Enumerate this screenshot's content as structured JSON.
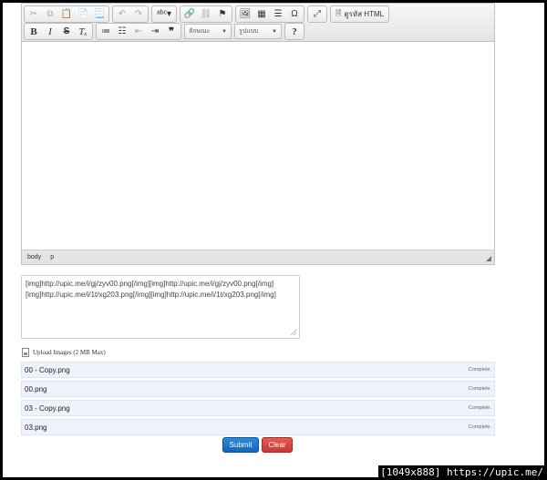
{
  "toolbar": {
    "source_label": "ดูรหัส HTML",
    "format_combo": "ลักษณะ",
    "style_combo": "รูปแบบ",
    "help_label": "?"
  },
  "statusbar": {
    "path": [
      "body",
      "p"
    ]
  },
  "bbcode": {
    "lines": [
      "[img]http://upic.me/i/gj/zyv00.png[/img][img]http://upic.me/i/gj/zyv00.png[/img]",
      "[img]http://upic.me/i/1t/xg203.png[/img][img]http://upic.me/i/1t/xg203.png[/img]"
    ]
  },
  "upload": {
    "label": "Upload Images (2 MB Max)"
  },
  "files": [
    {
      "name": "00 - Copy.png",
      "status": "Complete."
    },
    {
      "name": "00.png",
      "status": "Complete."
    },
    {
      "name": "03 - Copy.png",
      "status": "Complete."
    },
    {
      "name": "03.png",
      "status": "Complete."
    }
  ],
  "actions": {
    "submit": "Submit",
    "clear": "Clear"
  },
  "watermark": "[1049x888] https://upic.me/",
  "colors": {
    "submit": "#1565b8",
    "clear": "#c63a36",
    "file_row_bg": "#eef3fb"
  }
}
